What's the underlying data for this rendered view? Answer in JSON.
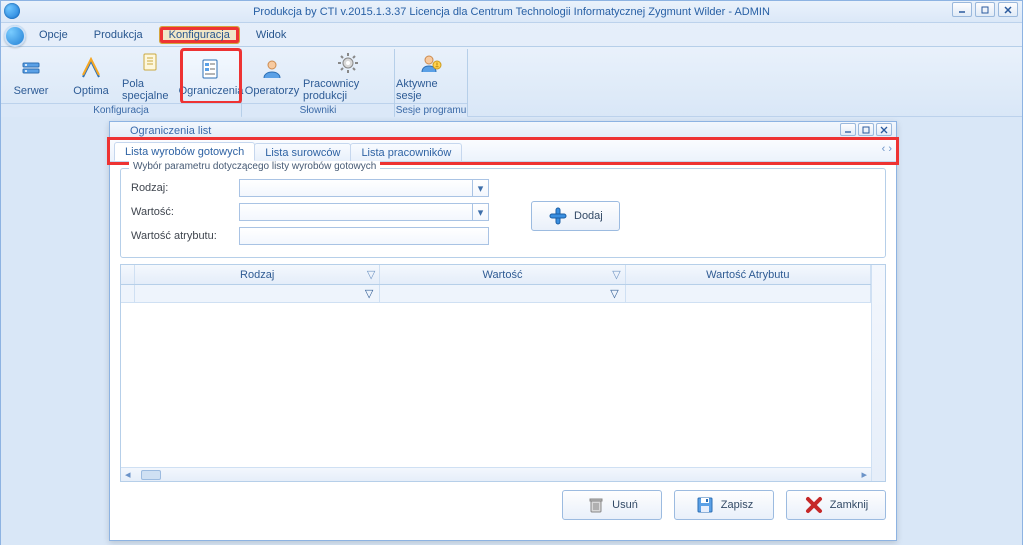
{
  "window": {
    "title": "Produkcja by CTI v.2015.1.3.37 Licencja dla Centrum Technologii Informatycznej Zygmunt Wilder - ADMIN"
  },
  "menu": {
    "items": [
      "Opcje",
      "Produkcja",
      "Konfiguracja",
      "Widok"
    ],
    "selected_index": 2
  },
  "ribbon": {
    "groups": [
      {
        "label": "Konfiguracja",
        "buttons": [
          {
            "label": "Serwer",
            "icon": "server-icon"
          },
          {
            "label": "Optima",
            "icon": "optima-icon"
          },
          {
            "label": "Pola specjalne",
            "icon": "fields-icon"
          },
          {
            "label": "Ograniczenia",
            "icon": "restrictions-icon",
            "highlighted": true
          }
        ]
      },
      {
        "label": "Słowniki",
        "buttons": [
          {
            "label": "Operatorzy",
            "icon": "user-icon"
          },
          {
            "label": "Pracownicy produkcji",
            "icon": "gear-icon",
            "wide": true
          }
        ]
      },
      {
        "label": "Sesje programu",
        "buttons": [
          {
            "label": "Aktywne sesje",
            "icon": "session-icon"
          }
        ]
      }
    ]
  },
  "child": {
    "title": "Ograniczenia list",
    "tabs": {
      "items": [
        "Lista wyrobów gotowych",
        "Lista surowców",
        "Lista pracowników"
      ],
      "active_index": 0
    },
    "form": {
      "legend": "Wybór parametru dotyczącego listy wyrobów gotowych",
      "rodzaj_label": "Rodzaj:",
      "wartosc_label": "Wartość:",
      "wartosc_atrybutu_label": "Wartość atrybutu:",
      "rodzaj_value": "",
      "wartosc_value": "",
      "wartosc_atrybutu_value": "",
      "add_button": "Dodaj"
    },
    "grid": {
      "columns": [
        "Rodzaj",
        "Wartość",
        "Wartość Atrybutu"
      ]
    },
    "footer": {
      "delete": "Usuń",
      "save": "Zapisz",
      "close": "Zamknij"
    }
  }
}
